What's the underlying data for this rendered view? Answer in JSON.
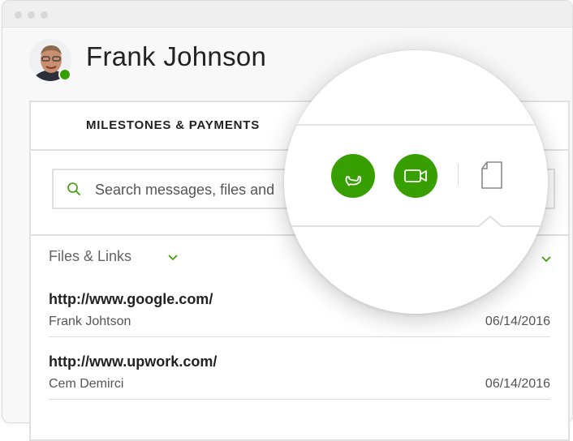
{
  "window": {
    "traffic_lights": [
      "close",
      "minimize",
      "maximize"
    ]
  },
  "header": {
    "user_name": "Frank Johnson",
    "status": "online",
    "status_color": "#37a000"
  },
  "tabs": {
    "active_label": "MILESTONES & PAYMENTS"
  },
  "search": {
    "placeholder_visible": "Search messages, files and"
  },
  "files": {
    "header_label": "Files & Links",
    "items": [
      {
        "url": "http://www.google.com/",
        "author": "Frank Johtson",
        "date": "06/14/2016"
      },
      {
        "url": "http://www.upwork.com/",
        "author": "Cem Demirci",
        "date": "06/14/2016"
      }
    ]
  },
  "toolbar": {
    "icons": [
      "phone-icon",
      "video-camera-icon",
      "file-icon"
    ],
    "accent_color": "#37a000"
  }
}
